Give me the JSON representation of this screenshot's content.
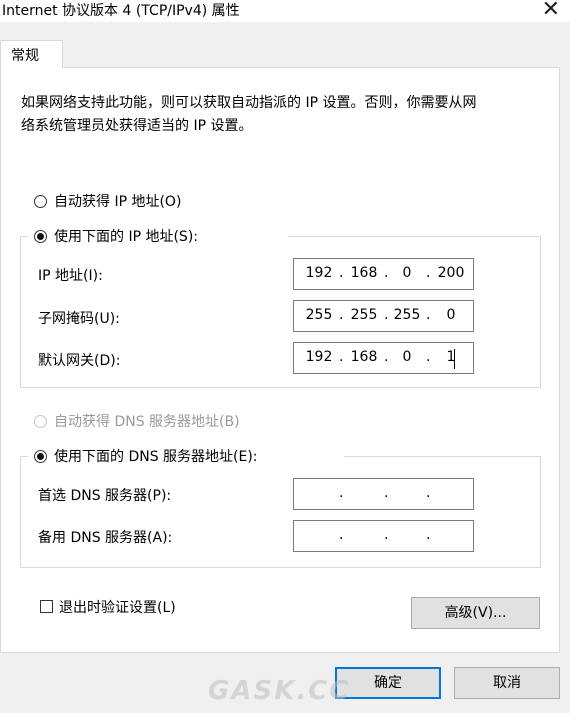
{
  "window": {
    "title": "Internet 协议版本 4 (TCP/IPv4) 属性"
  },
  "tabs": [
    {
      "label": "常规"
    }
  ],
  "description": {
    "line1": "如果网络支持此功能，则可以获取自动指派的 IP 设置。否则，你需要从网",
    "line2": "络系统管理员处获得适当的 IP 设置。"
  },
  "ip": {
    "auto_label": "自动获得 IP 地址(O)",
    "manual_label": "使用下面的 IP 地址(S):",
    "selected": "manual",
    "fields": {
      "address": {
        "label": "IP 地址(I):",
        "octets": [
          "192",
          "168",
          "0",
          "200"
        ]
      },
      "mask": {
        "label": "子网掩码(U):",
        "octets": [
          "255",
          "255",
          "255",
          "0"
        ]
      },
      "gateway": {
        "label": "默认网关(D):",
        "octets": [
          "192",
          "168",
          "0",
          "1"
        ]
      }
    }
  },
  "dns": {
    "auto_label": "自动获得 DNS 服务器地址(B)",
    "manual_label": "使用下面的 DNS 服务器地址(E):",
    "selected": "manual",
    "fields": {
      "preferred": {
        "label": "首选 DNS 服务器(P):",
        "octets": [
          "",
          "",
          "",
          ""
        ]
      },
      "alternate": {
        "label": "备用 DNS 服务器(A):",
        "octets": [
          "",
          "",
          "",
          ""
        ]
      }
    }
  },
  "validate": {
    "label": "退出时验证设置(L)",
    "checked": false
  },
  "buttons": {
    "advanced": "高级(V)...",
    "ok": "确定",
    "cancel": "取消"
  },
  "watermark": {
    "text": "GASK.CC"
  },
  "colors": {
    "focus_border": "#0078d7",
    "disabled_text": "#9a9a9a"
  }
}
